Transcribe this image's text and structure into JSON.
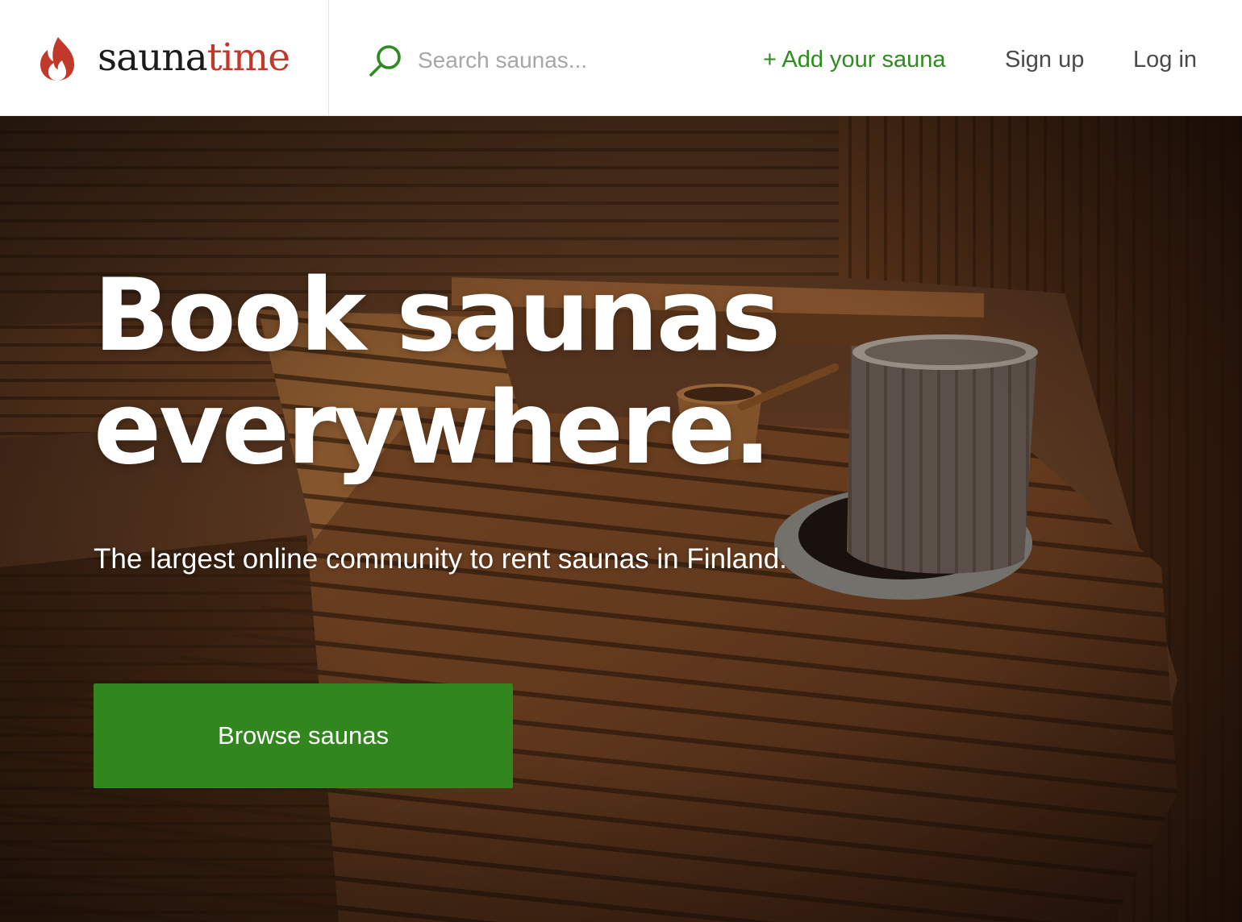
{
  "header": {
    "logo": {
      "text_main": "sauna",
      "text_accent": "time",
      "icon": "flame-icon"
    },
    "search": {
      "icon": "search-icon",
      "placeholder": "Search saunas...",
      "value": ""
    },
    "nav": {
      "add_sauna": "+ Add your sauna",
      "sign_up": "Sign up",
      "log_in": "Log in"
    }
  },
  "hero": {
    "title_line1": "Book saunas",
    "title_line2": "everywhere.",
    "subtitle": "The largest online community to rent saunas in Finland.",
    "cta_label": "Browse saunas",
    "background_image": "wooden sauna interior with benches, wooden bucket with ladle, and stone heater"
  },
  "colors": {
    "brand_red": "#c0392b",
    "accent_green": "#2e8b1f",
    "button_green": "#31861e",
    "nav_text": "#4a4a4a",
    "placeholder": "#a7a7a7"
  }
}
